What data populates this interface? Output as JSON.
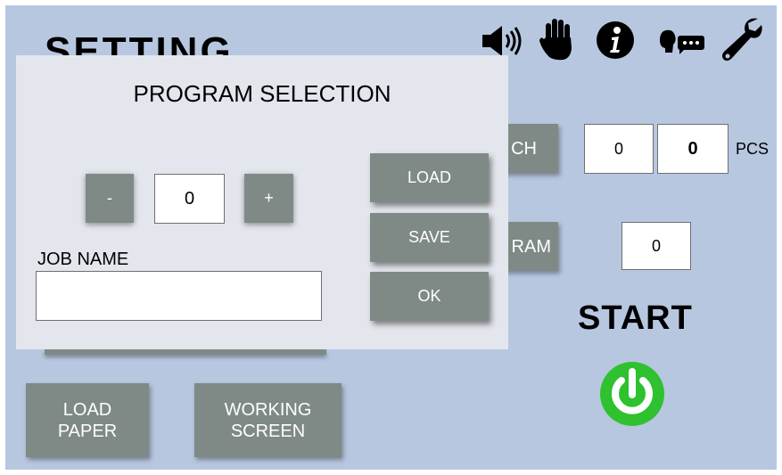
{
  "screen": {
    "title": "SETTING",
    "search_button_partial": "CH",
    "program_button_partial": "RAM",
    "count_left": "0",
    "count_right": "0",
    "count_unit": "PCS",
    "program_value": "0",
    "start_label": "START",
    "load_paper_line1": "LOAD",
    "load_paper_line2": "PAPER",
    "working_screen_line1": "WORKING",
    "working_screen_line2": "SCREEN"
  },
  "icons": [
    "speaker-icon",
    "hand-stop-icon",
    "info-icon",
    "voice-message-icon",
    "wrench-icon",
    "power-icon"
  ],
  "dialog": {
    "title": "PROGRAM SELECTION",
    "minus_label": "-",
    "plus_label": "+",
    "program_number": "0",
    "job_name_label": "JOB NAME",
    "job_name_value": "",
    "load_label": "LOAD",
    "save_label": "SAVE",
    "ok_label": "OK"
  },
  "colors": {
    "background": "#b7c7e0",
    "button": "#7f8a87",
    "dialog": "#e3e6ec",
    "power": "#2fc12f"
  }
}
